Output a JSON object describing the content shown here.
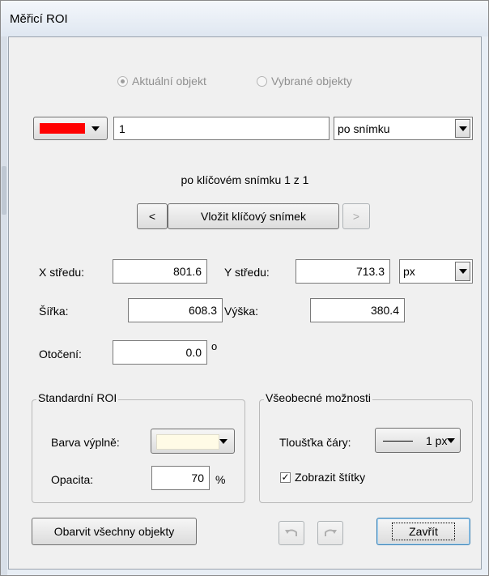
{
  "window": {
    "title": "Měřicí ROI"
  },
  "mode": {
    "options": [
      {
        "label": "Aktuální objekt",
        "selected": true
      },
      {
        "label": "Vybrané objekty",
        "selected": false
      }
    ]
  },
  "object": {
    "color": "#ff0000",
    "name_value": "1",
    "interpolation_value": "po snímku"
  },
  "keyframe": {
    "status_text": "po klíčovém snímku 1 z 1",
    "prev_label": "<",
    "insert_label": "Vložit klíčový snímek",
    "next_label": ">"
  },
  "geometry": {
    "x_center_label": "X středu:",
    "x_center_value": "801.6",
    "y_center_label": "Y středu:",
    "y_center_value": "713.3",
    "unit_value": "px",
    "width_label": "Šířka:",
    "width_value": "608.3",
    "height_label": "Výška:",
    "height_value": "380.4",
    "rotation_label": "Otočení:",
    "rotation_value": "0.0",
    "degree_symbol": "o"
  },
  "standard_roi": {
    "title": "Standardní ROI",
    "fill_color_label": "Barva výplně:",
    "fill_color": "#fffbe6",
    "opacity_label": "Opacita:",
    "opacity_value": "70",
    "opacity_unit": "%"
  },
  "general": {
    "title": "Všeobecné možnosti",
    "line_width_label": "Tloušťka čáry:",
    "line_width_value": "1 px",
    "show_labels_label": "Zobrazit štítky",
    "show_labels_checked": true
  },
  "footer": {
    "color_all_label": "Obarvit všechny objekty",
    "close_label": "Zavřít"
  }
}
